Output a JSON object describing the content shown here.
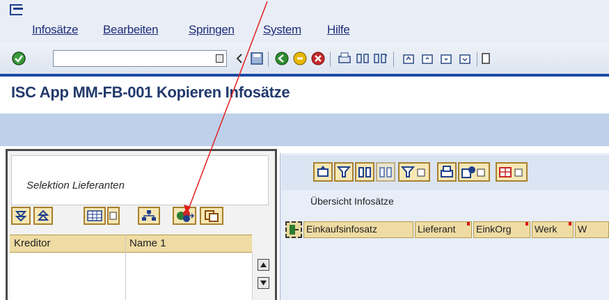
{
  "menubar": {
    "items": [
      {
        "label": "Infosätze"
      },
      {
        "label": "Bearbeiten"
      },
      {
        "label": "Springen"
      },
      {
        "label": "System"
      },
      {
        "label": "Hilfe"
      }
    ]
  },
  "toolbar": {
    "command_field_value": "",
    "icons": [
      "enter-check-icon",
      "back-icon",
      "save-icon",
      "back-arrow-icon",
      "exit-icon",
      "cancel-icon",
      "print-icon",
      "find-icon",
      "find-next-icon",
      "first-page-icon",
      "prev-page-icon",
      "next-page-icon",
      "last-page-icon"
    ]
  },
  "page": {
    "title": "ISC App MM-FB-001 Kopieren Infosätze"
  },
  "left_pane": {
    "selection_label": "Selektion Lieferanten",
    "columns": [
      "Kreditor",
      "Name 1"
    ]
  },
  "right_pane": {
    "overview_label": "Übersicht Infosätze",
    "columns": [
      "Einkaufsinfosatz",
      "Lieferant",
      "EinkOrg",
      "Werk",
      "W"
    ]
  },
  "colors": {
    "accent_blue": "#1b4aa6",
    "band": "#bfd0ea",
    "button_fill": "#f6e7b4",
    "header_fill": "#efdca4",
    "annotation_arrow": "#e02020"
  }
}
